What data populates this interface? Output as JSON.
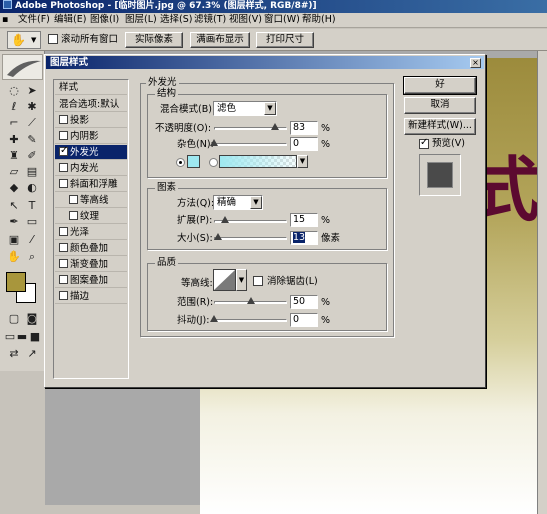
{
  "app": {
    "title": "Adobe Photoshop - [临时图片.jpg @ 67.3% (图层样式, RGB/8#)]"
  },
  "menu": [
    {
      "label": "文件(F)"
    },
    {
      "label": "编辑(E)"
    },
    {
      "label": "图像(I)"
    },
    {
      "label": "图层(L)"
    },
    {
      "label": "选择(S)"
    },
    {
      "label": "滤镜(T)"
    },
    {
      "label": "视图(V)"
    },
    {
      "label": "窗口(W)"
    },
    {
      "label": "帮助(H)"
    }
  ],
  "options_bar": {
    "scroll_all_windows": "滚动所有窗口",
    "scroll_all_checked": false,
    "actual_pixels": "实际像素",
    "fit_on_screen": "满画布显示",
    "print_size": "打印尺寸"
  },
  "dialog": {
    "title": "图层样式",
    "close_glyph": "×",
    "styles_list": [
      {
        "label": "样式",
        "type": "header"
      },
      {
        "label": "混合选项:默认",
        "type": "header"
      },
      {
        "label": "投影",
        "checked": false
      },
      {
        "label": "内阴影",
        "checked": false
      },
      {
        "label": "外发光",
        "checked": true,
        "selected": true
      },
      {
        "label": "内发光",
        "checked": false
      },
      {
        "label": "斜面和浮雕",
        "checked": false
      },
      {
        "label": "等高线",
        "checked": false,
        "indent": true
      },
      {
        "label": "纹理",
        "checked": false,
        "indent": true
      },
      {
        "label": "光泽",
        "checked": false
      },
      {
        "label": "颜色叠加",
        "checked": false
      },
      {
        "label": "渐变叠加",
        "checked": false
      },
      {
        "label": "图案叠加",
        "checked": false
      },
      {
        "label": "描边",
        "checked": false
      }
    ],
    "outer_glow": {
      "title": "外发光",
      "structure": {
        "title": "结构",
        "blend_mode_label": "混合模式(B):",
        "blend_mode_value": "滤色",
        "opacity_label": "不透明度(O):",
        "opacity_value": "83",
        "opacity_fraction": 0.83,
        "noise_label": "杂色(N):",
        "noise_value": "0",
        "noise_fraction": 0,
        "percent": "%",
        "glow_color": "#9ee8f0"
      },
      "elements": {
        "title": "图素",
        "technique_label": "方法(Q):",
        "technique_value": "精确",
        "spread_label": "扩展(P):",
        "spread_value": "15",
        "spread_fraction": 0.15,
        "size_label": "大小(S):",
        "size_value": "13",
        "size_fraction": 0.052,
        "percent": "%",
        "size_unit": "像素"
      },
      "quality": {
        "title": "品质",
        "contour_label": "等高线:",
        "anti_alias_label": "消除锯齿(L)",
        "anti_alias_checked": false,
        "range_label": "范围(R):",
        "range_value": "50",
        "range_fraction": 0.5,
        "jitter_label": "抖动(J):",
        "jitter_value": "0",
        "jitter_fraction": 0,
        "percent": "%"
      }
    },
    "buttons": {
      "ok": "好",
      "cancel": "取消",
      "new_style": "新建样式(W)...",
      "preview_label": "预览(V)",
      "preview_checked": true
    }
  },
  "colors": {
    "foreground": "#a8963c",
    "background": "#ffffff",
    "title_bar": "#0a246a"
  }
}
